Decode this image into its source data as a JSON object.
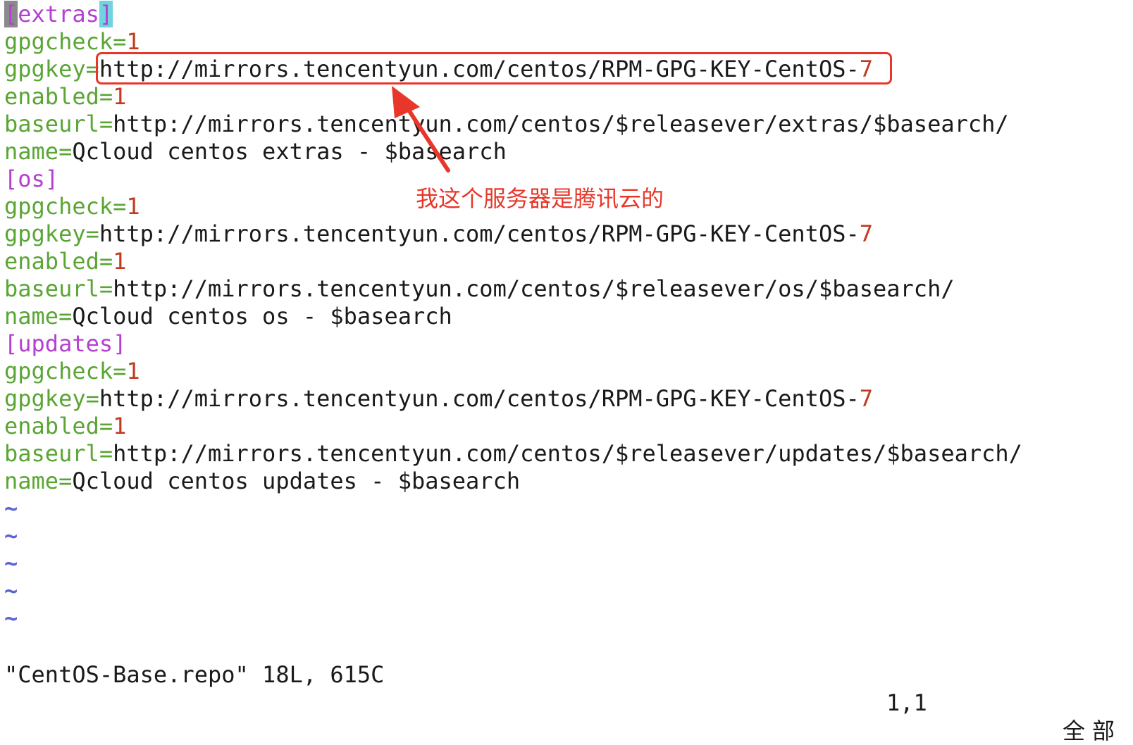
{
  "lines": [
    [
      {
        "t": "[",
        "c": "cursor"
      },
      {
        "t": "extras",
        "c": "s"
      },
      {
        "t": "]",
        "c": "brk-hl"
      }
    ],
    [
      {
        "t": "gpgcheck=",
        "c": "k"
      },
      {
        "t": "1",
        "c": "n"
      }
    ],
    [
      {
        "t": "gpgkey=",
        "c": "k"
      },
      {
        "t": "http://mirrors.tencentyun.com/centos/RPM-GPG-KEY-CentOS-",
        "c": ""
      },
      {
        "t": "7",
        "c": "n"
      }
    ],
    [
      {
        "t": "enabled=",
        "c": "k"
      },
      {
        "t": "1",
        "c": "n"
      }
    ],
    [
      {
        "t": "baseurl=",
        "c": "k"
      },
      {
        "t": "http://mirrors.tencentyun.com/centos/$releasever/extras/$basearch/",
        "c": ""
      }
    ],
    [
      {
        "t": "name=",
        "c": "k"
      },
      {
        "t": "Qcloud centos extras - $basearch",
        "c": ""
      }
    ],
    [
      {
        "t": "[os]",
        "c": "s"
      }
    ],
    [
      {
        "t": "gpgcheck=",
        "c": "k"
      },
      {
        "t": "1",
        "c": "n"
      }
    ],
    [
      {
        "t": "gpgkey=",
        "c": "k"
      },
      {
        "t": "http://mirrors.tencentyun.com/centos/RPM-GPG-KEY-CentOS-",
        "c": ""
      },
      {
        "t": "7",
        "c": "n"
      }
    ],
    [
      {
        "t": "enabled=",
        "c": "k"
      },
      {
        "t": "1",
        "c": "n"
      }
    ],
    [
      {
        "t": "baseurl=",
        "c": "k"
      },
      {
        "t": "http://mirrors.tencentyun.com/centos/$releasever/os/$basearch/",
        "c": ""
      }
    ],
    [
      {
        "t": "name=",
        "c": "k"
      },
      {
        "t": "Qcloud centos os - $basearch",
        "c": ""
      }
    ],
    [
      {
        "t": "[updates]",
        "c": "s"
      }
    ],
    [
      {
        "t": "gpgcheck=",
        "c": "k"
      },
      {
        "t": "1",
        "c": "n"
      }
    ],
    [
      {
        "t": "gpgkey=",
        "c": "k"
      },
      {
        "t": "http://mirrors.tencentyun.com/centos/RPM-GPG-KEY-CentOS-",
        "c": ""
      },
      {
        "t": "7",
        "c": "n"
      }
    ],
    [
      {
        "t": "enabled=",
        "c": "k"
      },
      {
        "t": "1",
        "c": "n"
      }
    ],
    [
      {
        "t": "baseurl=",
        "c": "k"
      },
      {
        "t": "http://mirrors.tencentyun.com/centos/$releasever/updates/$basearch/",
        "c": ""
      }
    ],
    [
      {
        "t": "name=",
        "c": "k"
      },
      {
        "t": "Qcloud centos updates - $basearch",
        "c": ""
      }
    ]
  ],
  "empty_marker": "~",
  "empty_count": 5,
  "status": {
    "file": "\"CentOS-Base.repo\" 18L, 615C",
    "position": "1,1",
    "scroll": "全部"
  },
  "annotation": {
    "text": "我这个服务器是腾讯云的",
    "color": "#e8372a"
  },
  "colors": {
    "key": "#5aa534",
    "number": "#c23a1f",
    "section": "#b53fd0",
    "tilde": "#5b63d8",
    "annotation": "#e8372a"
  }
}
